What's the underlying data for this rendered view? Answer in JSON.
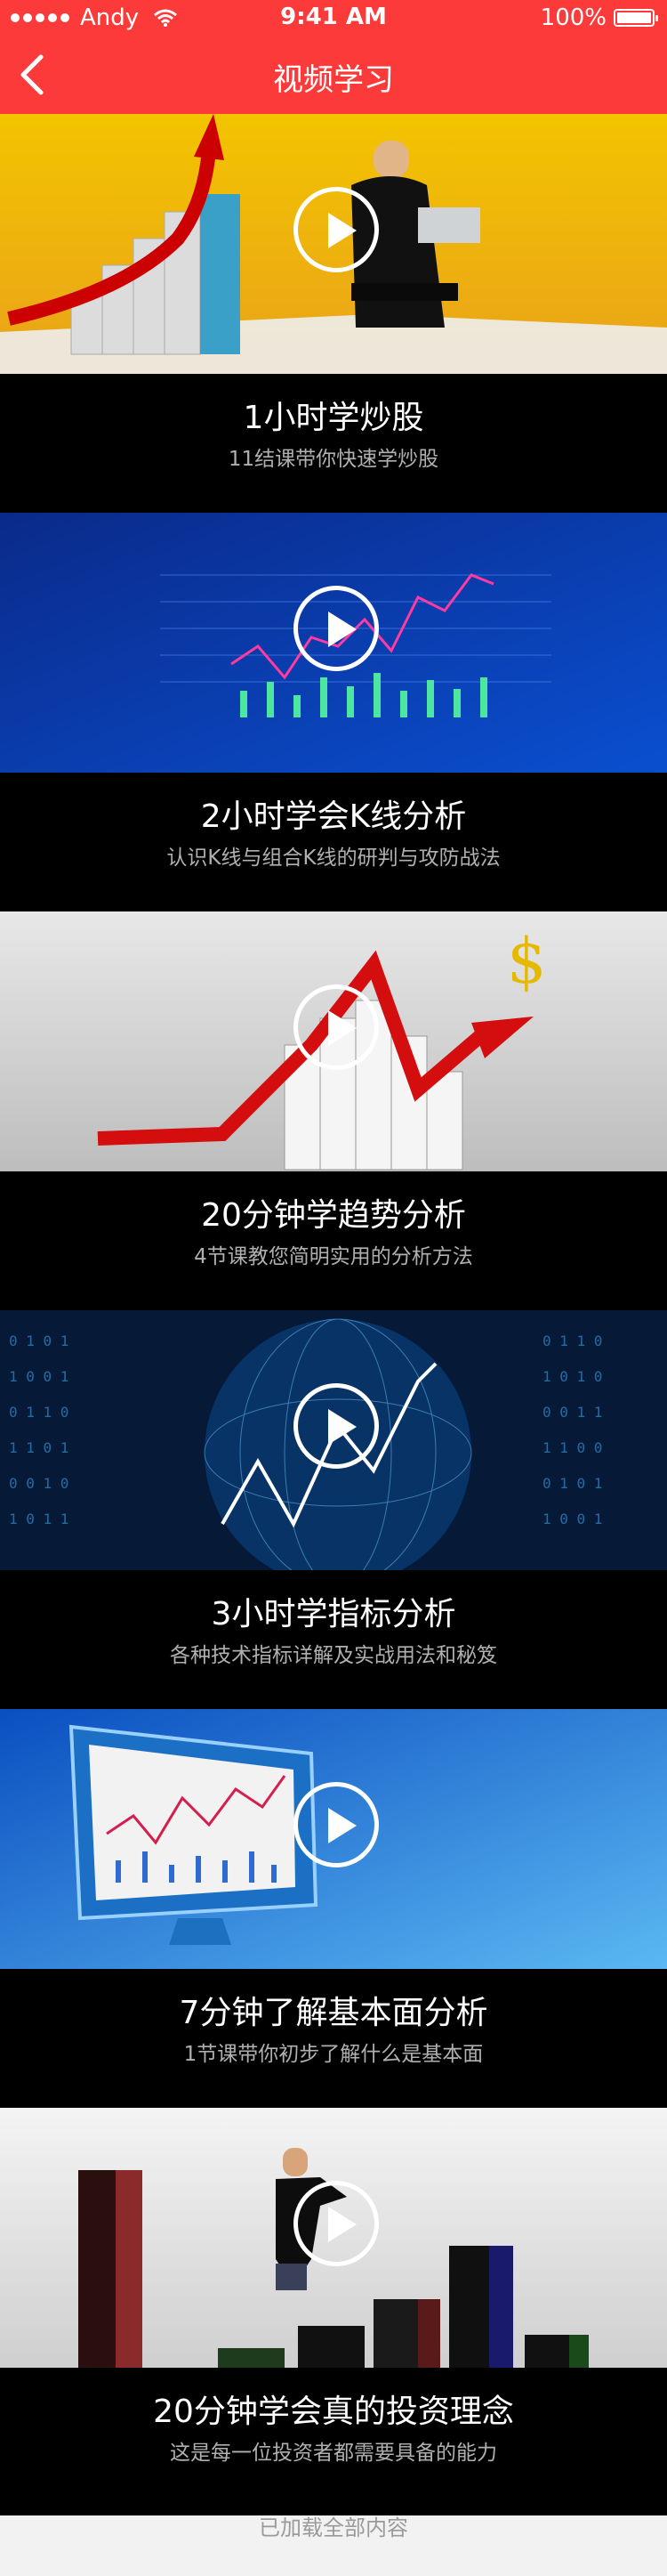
{
  "status_bar": {
    "carrier": "Andy",
    "time": "9:41 AM",
    "battery": "100%"
  },
  "nav": {
    "title": "视频学习"
  },
  "courses": [
    {
      "title": "1小时学炒股",
      "subtitle": "11结课带你快速学炒股"
    },
    {
      "title": "2小时学会K线分析",
      "subtitle": "认识K线与组合K线的研判与攻防战法"
    },
    {
      "title": "20分钟学趋势分析",
      "subtitle": "4节课教您简明实用的分析方法"
    },
    {
      "title": "3小时学指标分析",
      "subtitle": "各种技术指标详解及实战用法和秘笈"
    },
    {
      "title": "7分钟了解基本面分析",
      "subtitle": "1节课带你初步了解什么是基本面"
    },
    {
      "title": "20分钟学会真的投资理念",
      "subtitle": "这是每一位投资者都需要具备的能力"
    }
  ],
  "footer": {
    "text": "已加载全部内容"
  },
  "colors": {
    "brand_red": "#fc3a3a",
    "card_bg": "#000000",
    "page_bg": "#f2f2f2"
  }
}
